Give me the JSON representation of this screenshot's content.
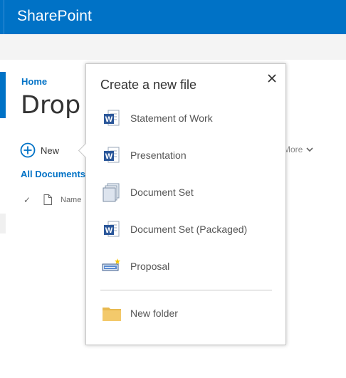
{
  "app": {
    "brand": "SharePoint"
  },
  "page": {
    "breadcrumb": "Home",
    "title": "Drop Off Library",
    "new_label": "New",
    "more_label": "More",
    "view_label": "All Documents",
    "list": {
      "check": "✓",
      "name_column": "Name"
    }
  },
  "new_file_panel": {
    "title": "Create a new file",
    "items": [
      {
        "label": "Statement of Work",
        "icon": "word-icon"
      },
      {
        "label": "Presentation",
        "icon": "word-icon"
      },
      {
        "label": "Document Set",
        "icon": "document-set-icon"
      },
      {
        "label": "Document Set (Packaged)",
        "icon": "word-icon"
      },
      {
        "label": "Proposal",
        "icon": "proposal-icon"
      }
    ],
    "folder_label": "New folder"
  },
  "colors": {
    "suite_bar": "#0072c6",
    "link": "#0072c6",
    "word_blue": "#2b579a",
    "folder_yellow": "#f3c96b"
  }
}
